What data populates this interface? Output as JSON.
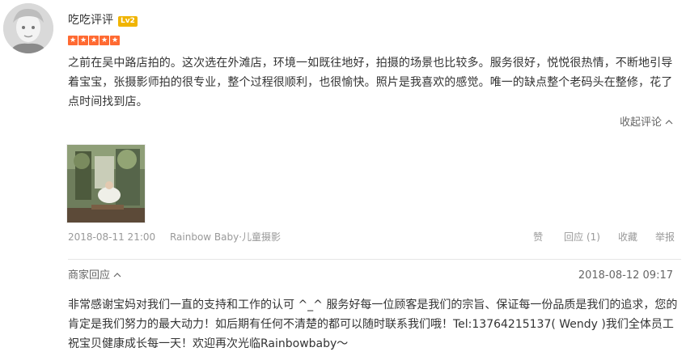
{
  "user": {
    "name": "吃吃评评",
    "level": "Lv2",
    "rating": 5
  },
  "review": {
    "text": "之前在吴中路店拍的。这次选在外滩店，环境一如既往地好，拍摄的场景也比较多。服务很好，悦悦很热情，不断地引导着宝宝，张摄影师拍的很专业，整个过程很顺利，也很愉快。照片是我喜欢的感觉。唯一的缺点整个老码头在整修，花了点时间找到店。",
    "collapse_label": "收起评论"
  },
  "meta": {
    "datetime": "2018-08-11 21:00",
    "shop": "Rainbow Baby·儿童摄影"
  },
  "actions": {
    "like": "赞",
    "reply": "回应",
    "reply_count": "(1)",
    "favorite": "收藏",
    "report": "举报"
  },
  "merchant_reply": {
    "label": "商家回应",
    "date": "2018-08-12 09:17",
    "text": "非常感谢宝妈对我们一直的支持和工作的认可 ^_^ 服务好每一位顾客是我们的宗旨、保证每一份品质是我们的追求，您的肯定是我们努力的最大动力！如后期有任何不清楚的都可以随时联系我们哦！Tel:13764215137( Wendy )我们全体员工祝宝贝健康成长每一天！欢迎再次光临Rainbowbaby～"
  },
  "colors": {
    "accent": "#ff6a32",
    "level_badge": "#f0b400"
  },
  "icons": {
    "stars": "star-icon",
    "collapse": "chevron-up-icon",
    "reply_toggle": "chevron-up-icon"
  }
}
